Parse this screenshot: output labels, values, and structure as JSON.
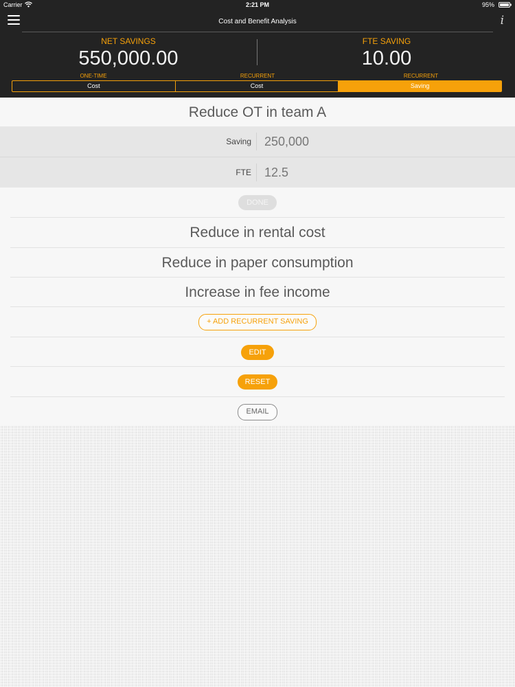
{
  "status_bar": {
    "carrier": "Carrier",
    "time": "2:21 PM",
    "battery": "95%"
  },
  "header": {
    "title": "Cost and Benefit Analysis",
    "net_savings_label": "NET SAVINGS",
    "net_savings_value": "550,000.00",
    "fte_saving_label": "FTE SAVING",
    "fte_saving_value": "10.00"
  },
  "segments": [
    {
      "caption": "ONE-TIME",
      "label": "Cost",
      "active": false
    },
    {
      "caption": "RECURRENT",
      "label": "Cost",
      "active": false
    },
    {
      "caption": "RECURRENT",
      "label": "Saving",
      "active": true
    }
  ],
  "items": [
    {
      "title": "Reduce OT in team A"
    },
    {
      "title": "Reduce in rental cost"
    },
    {
      "title": "Reduce in paper consumption"
    },
    {
      "title": "Increase in fee income"
    }
  ],
  "editor": {
    "saving_label": "Saving",
    "saving_value": "250,000",
    "fte_label": "FTE",
    "fte_value": "12.5",
    "done_label": "DONE"
  },
  "actions": {
    "add_label": "+ ADD RECURRENT SAVING",
    "edit_label": "EDIT",
    "reset_label": "RESET",
    "email_label": "EMAIL"
  },
  "colors": {
    "accent": "#f6a10a",
    "header_bg": "#232323"
  }
}
